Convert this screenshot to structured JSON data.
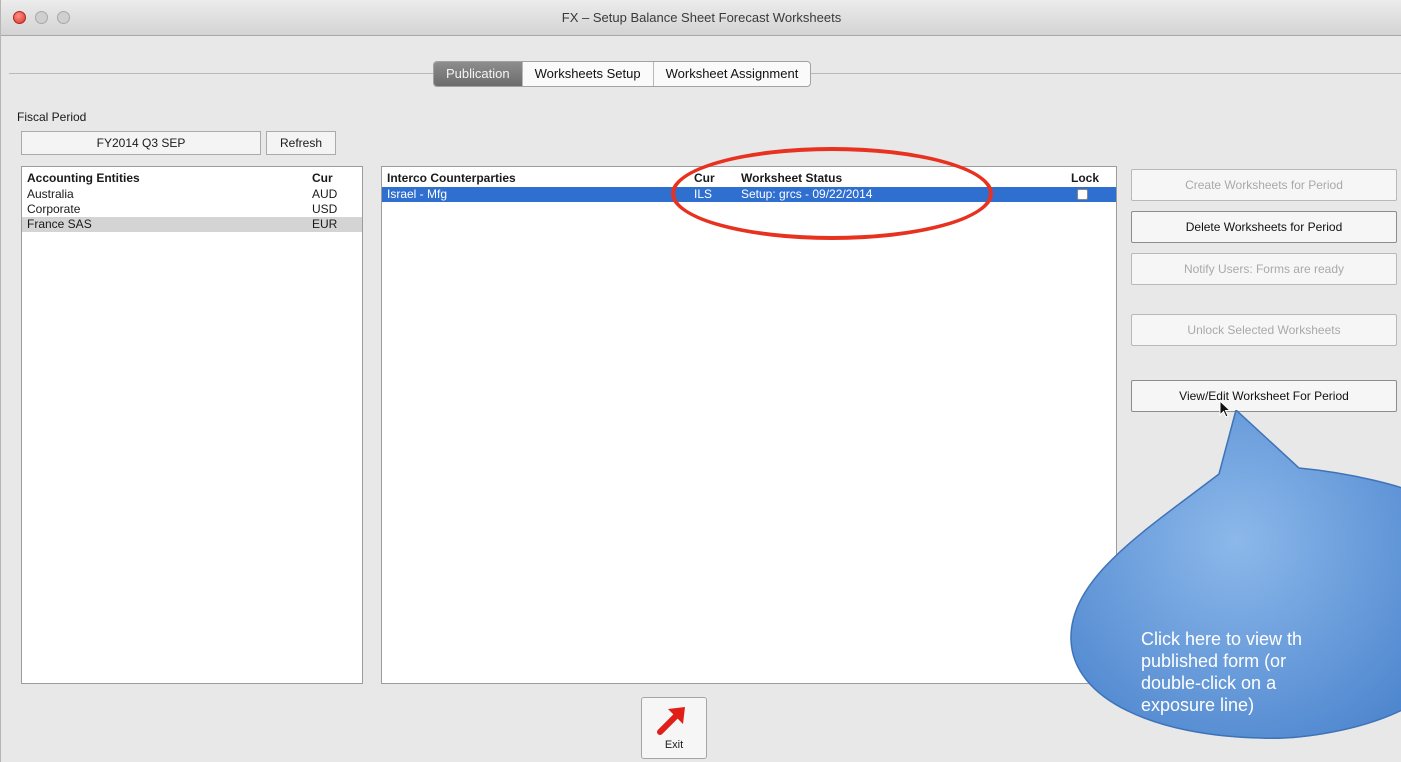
{
  "window": {
    "title": "FX – Setup Balance Sheet Forecast Worksheets"
  },
  "tabs": [
    {
      "label": "Publication",
      "active": true
    },
    {
      "label": "Worksheets Setup",
      "active": false
    },
    {
      "label": "Worksheet Assignment",
      "active": false
    }
  ],
  "fiscal_period": {
    "label": "Fiscal Period",
    "value": "FY2014 Q3 SEP",
    "refresh_label": "Refresh"
  },
  "entities": {
    "headers": {
      "name": "Accounting Entities",
      "cur": "Cur"
    },
    "rows": [
      {
        "name": "Australia",
        "cur": "AUD"
      },
      {
        "name": "Corporate",
        "cur": "USD"
      },
      {
        "name": "France SAS",
        "cur": "EUR"
      }
    ]
  },
  "counterparties": {
    "headers": {
      "name": "Interco Counterparties",
      "cur": "Cur",
      "status": "Worksheet Status",
      "lock": "Lock"
    },
    "rows": [
      {
        "name": "Israel - Mfg",
        "cur": "ILS",
        "status": "Setup: grcs - 09/22/2014",
        "locked": false
      }
    ]
  },
  "actions": [
    {
      "label": "Create Worksheets for Period",
      "enabled": false
    },
    {
      "label": "Delete Worksheets for Period",
      "enabled": true
    },
    {
      "label": "Notify Users: Forms are ready",
      "enabled": false
    },
    {
      "label": "Unlock Selected Worksheets",
      "enabled": false
    },
    {
      "label": "View/Edit Worksheet For Period",
      "enabled": true
    }
  ],
  "exit": {
    "label": "Exit"
  },
  "annotation": {
    "callout_lines": [
      "Click here to view th",
      "published form (or",
      "double-click on a",
      "exposure line)"
    ]
  },
  "colors": {
    "selection_blue": "#2f6fd0",
    "annotation_red": "#e8311f",
    "callout_blue": "#6fa4e0"
  }
}
